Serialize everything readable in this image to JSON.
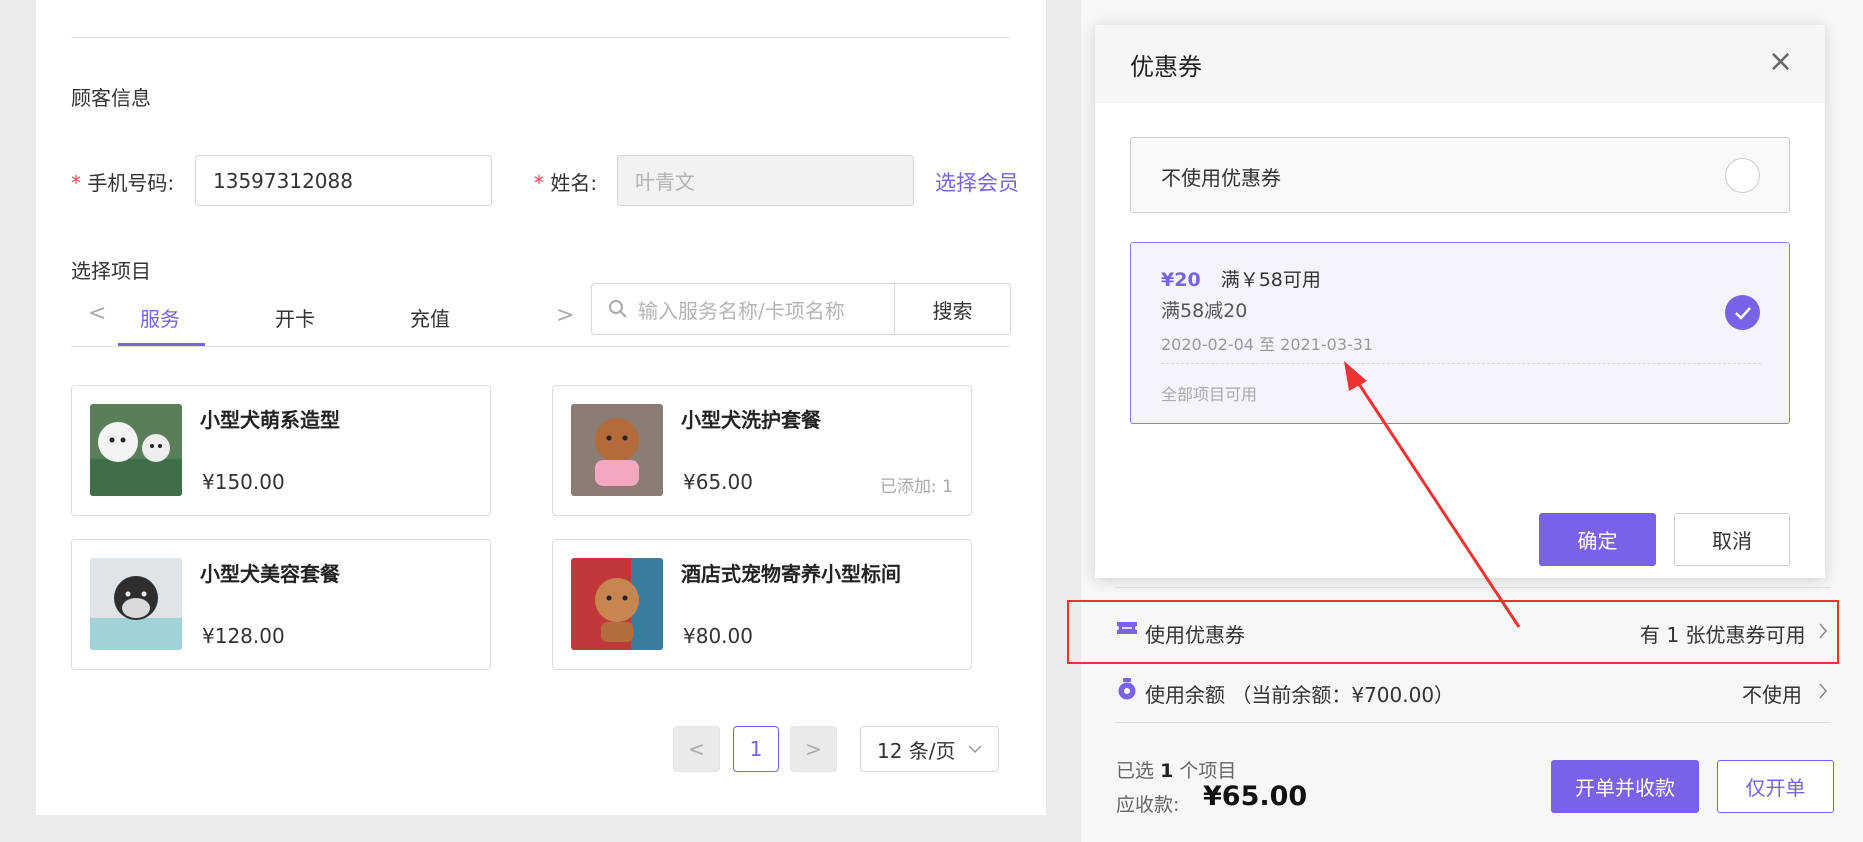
{
  "customer": {
    "section_title": "顾客信息",
    "required_mark": "*",
    "phone_label": "手机号码:",
    "phone_value": "13597312088",
    "name_label": "姓名:",
    "name_placeholder": "叶青文",
    "select_member": "选择会员"
  },
  "project": {
    "section_title": "选择项目",
    "prev_arrow": "<",
    "next_arrow": ">",
    "tabs": [
      {
        "label": "服务",
        "active": true
      },
      {
        "label": "开卡",
        "active": false
      },
      {
        "label": "充值",
        "active": false
      }
    ],
    "search_placeholder": "输入服务名称/卡项名称",
    "search_button": "搜索"
  },
  "items": [
    {
      "name": "小型犬萌系造型",
      "price": "¥150.00",
      "added": ""
    },
    {
      "name": "小型犬洗护套餐",
      "price": "¥65.00",
      "added": "已添加: 1"
    },
    {
      "name": "小型犬美容套餐",
      "price": "¥128.00",
      "added": ""
    },
    {
      "name": "酒店式宠物寄养小型标间",
      "price": "¥80.00",
      "added": ""
    }
  ],
  "pagination": {
    "prev": "<",
    "current": "1",
    "next": ">",
    "page_size": "12 条/页"
  },
  "modal": {
    "title": "优惠券",
    "close": "×",
    "no_coupon": "不使用优惠券",
    "coupon": {
      "amount": "¥20",
      "condition": "满￥58可用",
      "name": "满58减20",
      "validity": "2020-02-04 至 2021-03-31",
      "scope": "全部项目可用",
      "selected": true
    },
    "confirm": "确定",
    "cancel": "取消"
  },
  "summary": {
    "use_coupon_label": "使用优惠券",
    "coupon_available": "有 1 张优惠券可用",
    "use_balance_label": "使用余额 （当前余额：¥700.00）",
    "balance_status": "不使用",
    "selected_prefix": "已选",
    "selected_count": "1",
    "selected_suffix": "个项目",
    "receivable_label": "应收款:",
    "receivable_amount": "¥65.00",
    "open_and_pay": "开单并收款",
    "open_only": "仅开单"
  },
  "colors": {
    "accent": "#7a62e6",
    "annotation": "#f03232"
  }
}
